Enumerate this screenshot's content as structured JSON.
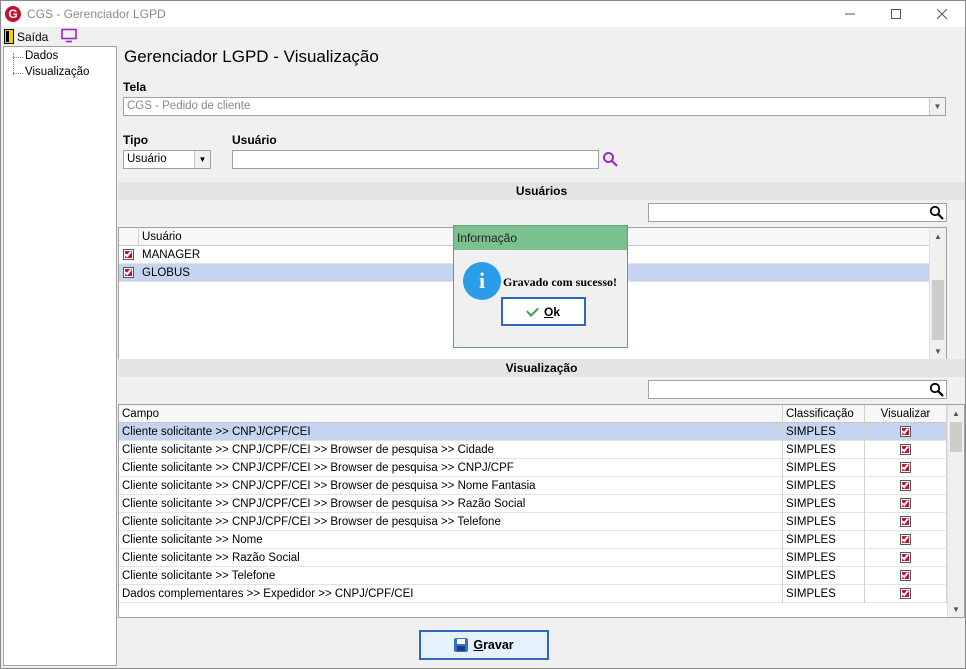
{
  "window": {
    "title": "CGS - Gerenciador LGPD",
    "logo_letter": "G"
  },
  "toolbar": {
    "exit_label": "Saída"
  },
  "tree": {
    "items": [
      {
        "label": "Dados"
      },
      {
        "label": "Visualização"
      }
    ]
  },
  "page_title": "Gerenciador LGPD - Visualização",
  "tela": {
    "label": "Tela",
    "value": "CGS - Pedido de cliente"
  },
  "tipo": {
    "label": "Tipo",
    "value": "Usuário"
  },
  "usuario": {
    "label": "Usuário",
    "value": ""
  },
  "users_section": {
    "title": "Usuários",
    "search_value": "",
    "column": "Usuário",
    "rows": [
      {
        "name": "MANAGER",
        "checked": true
      },
      {
        "name": "GLOBUS",
        "checked": true,
        "selected": true
      }
    ]
  },
  "view_section": {
    "title": "Visualização",
    "search_value": "",
    "columns": {
      "campo": "Campo",
      "classificacao": "Classificação",
      "visualizar": "Visualizar"
    },
    "rows": [
      {
        "campo": "Cliente solicitante >> CNPJ/CPF/CEI",
        "classificacao": "SIMPLES",
        "visualizar": true,
        "selected": true
      },
      {
        "campo": "Cliente solicitante >> CNPJ/CPF/CEI >> Browser de pesquisa >> Cidade",
        "classificacao": "SIMPLES",
        "visualizar": true
      },
      {
        "campo": "Cliente solicitante >> CNPJ/CPF/CEI >> Browser de pesquisa >> CNPJ/CPF",
        "classificacao": "SIMPLES",
        "visualizar": true
      },
      {
        "campo": "Cliente solicitante >> CNPJ/CPF/CEI >> Browser de pesquisa >> Nome Fantasia",
        "classificacao": "SIMPLES",
        "visualizar": true
      },
      {
        "campo": "Cliente solicitante >> CNPJ/CPF/CEI >> Browser de pesquisa >> Razão Social",
        "classificacao": "SIMPLES",
        "visualizar": true
      },
      {
        "campo": "Cliente solicitante >> CNPJ/CPF/CEI >> Browser de pesquisa >> Telefone",
        "classificacao": "SIMPLES",
        "visualizar": true
      },
      {
        "campo": "Cliente solicitante >> Nome",
        "classificacao": "SIMPLES",
        "visualizar": true
      },
      {
        "campo": "Cliente solicitante >> Razão Social",
        "classificacao": "SIMPLES",
        "visualizar": true
      },
      {
        "campo": "Cliente solicitante >> Telefone",
        "classificacao": "SIMPLES",
        "visualizar": true
      },
      {
        "campo": "Dados complementares >> Expedidor >> CNPJ/CPF/CEI",
        "classificacao": "SIMPLES",
        "visualizar": true
      }
    ]
  },
  "save_button": {
    "label_first": "G",
    "label_rest": "ravar"
  },
  "dialog": {
    "title": "Informação",
    "icon": "info-icon",
    "message": "Gravado com sucesso!",
    "ok_first": "O",
    "ok_rest": "k"
  },
  "colors": {
    "selection": "#c4d4f1",
    "dialog_header": "#7bc18f",
    "check": "#c8102e",
    "button_border": "#2f66c0"
  }
}
